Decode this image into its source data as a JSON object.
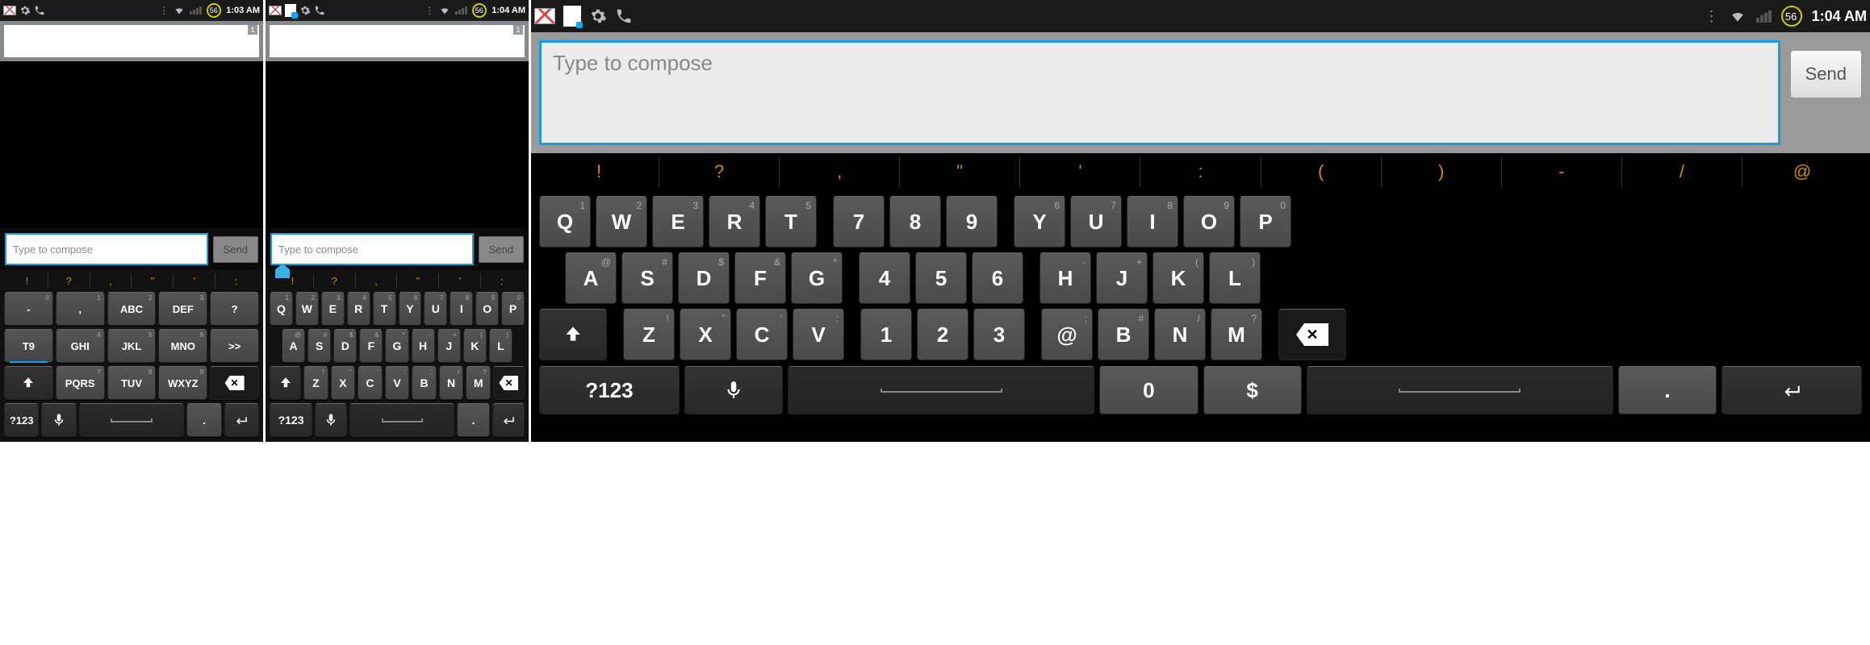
{
  "screens": [
    {
      "status": {
        "time": "1:03 AM",
        "battery": "56",
        "has_sd": false
      },
      "recipient_count": "1",
      "compose_placeholder": "Type to compose",
      "send_label": "Send",
      "keyboard_type": "t9",
      "punct": [
        "!",
        "?",
        ",",
        "\"",
        "'",
        ":"
      ],
      "t9_rows": [
        [
          {
            "main": "-",
            "sup": "0"
          },
          {
            "main": ",",
            "sup": "1"
          },
          {
            "main": "ABC",
            "sup": "2"
          },
          {
            "main": "DEF",
            "sup": "3"
          },
          {
            "main": "?",
            "sup": ""
          }
        ],
        [
          {
            "main": "T9",
            "sup": "",
            "t9": true
          },
          {
            "main": "GHI",
            "sup": "4"
          },
          {
            "main": "JKL",
            "sup": "5"
          },
          {
            "main": "MNO",
            "sup": "6"
          },
          {
            "main": ">>",
            "sup": ""
          }
        ],
        [
          {
            "main": "shift",
            "sup": ""
          },
          {
            "main": "PQRS",
            "sup": "7"
          },
          {
            "main": "TUV",
            "sup": "8"
          },
          {
            "main": "WXYZ",
            "sup": "9"
          },
          {
            "main": "backspace",
            "sup": ""
          }
        ],
        [
          {
            "main": "?123",
            "sup": ""
          },
          {
            "main": "mic",
            "sup": ""
          },
          {
            "main": "space",
            "sup": ""
          },
          {
            "main": ".",
            "sup": ""
          },
          {
            "main": "enter",
            "sup": ""
          }
        ]
      ]
    },
    {
      "status": {
        "time": "1:04 AM",
        "battery": "56",
        "has_sd": true
      },
      "recipient_count": "1",
      "compose_placeholder": "Type to compose",
      "send_label": "Send",
      "keyboard_type": "qwerty",
      "punct": [
        "!",
        "?",
        ",",
        "\"",
        "'",
        ":"
      ],
      "qwerty_rows": [
        [
          {
            "main": "Q",
            "sup": "1"
          },
          {
            "main": "W",
            "sup": "2"
          },
          {
            "main": "E",
            "sup": "3"
          },
          {
            "main": "R",
            "sup": "4"
          },
          {
            "main": "T",
            "sup": "5"
          },
          {
            "main": "Y",
            "sup": "6"
          },
          {
            "main": "U",
            "sup": "7"
          },
          {
            "main": "I",
            "sup": "8"
          },
          {
            "main": "O",
            "sup": "9"
          },
          {
            "main": "P",
            "sup": "0"
          }
        ],
        [
          {
            "main": "A",
            "sup": "@"
          },
          {
            "main": "S",
            "sup": "#"
          },
          {
            "main": "D",
            "sup": "$"
          },
          {
            "main": "F",
            "sup": "&"
          },
          {
            "main": "G",
            "sup": "*"
          },
          {
            "main": "H",
            "sup": "-"
          },
          {
            "main": "J",
            "sup": "+"
          },
          {
            "main": "K",
            "sup": "("
          },
          {
            "main": "L",
            "sup": ")"
          }
        ],
        [
          {
            "main": "shift",
            "sup": ""
          },
          {
            "main": "Z",
            "sup": "!"
          },
          {
            "main": "X",
            "sup": "\""
          },
          {
            "main": "C",
            "sup": "'"
          },
          {
            "main": "V",
            "sup": ":"
          },
          {
            "main": "B",
            "sup": ";"
          },
          {
            "main": "N",
            "sup": "/"
          },
          {
            "main": "M",
            "sup": "?"
          },
          {
            "main": "backspace",
            "sup": ""
          }
        ],
        [
          {
            "main": "?123",
            "sup": ""
          },
          {
            "main": "mic",
            "sup": ""
          },
          {
            "main": "space",
            "sup": ""
          },
          {
            "main": ".",
            "sup": ""
          },
          {
            "main": "enter",
            "sup": ""
          }
        ]
      ]
    },
    {
      "status": {
        "time": "1:04 AM",
        "battery": "56",
        "has_sd": true
      },
      "compose_placeholder": "Type to compose",
      "send_label": "Send",
      "keyboard_type": "qwerty_land",
      "punct": [
        "!",
        "?",
        ",",
        "\"",
        "'",
        ":",
        "(",
        ")",
        "-",
        "/",
        "@"
      ],
      "land_rows": [
        {
          "group1": [
            {
              "main": "Q",
              "sup": "1"
            },
            {
              "main": "W",
              "sup": "2"
            },
            {
              "main": "E",
              "sup": "3"
            },
            {
              "main": "R",
              "sup": "4"
            },
            {
              "main": "T",
              "sup": "5"
            }
          ],
          "group2": [
            {
              "main": "7",
              "sup": ""
            },
            {
              "main": "8",
              "sup": ""
            },
            {
              "main": "9",
              "sup": ""
            }
          ],
          "group3": [
            {
              "main": "Y",
              "sup": "6"
            },
            {
              "main": "U",
              "sup": "7"
            },
            {
              "main": "I",
              "sup": "8"
            },
            {
              "main": "O",
              "sup": "9"
            },
            {
              "main": "P",
              "sup": "0"
            }
          ]
        },
        {
          "group1": [
            {
              "main": "A",
              "sup": "@"
            },
            {
              "main": "S",
              "sup": "#"
            },
            {
              "main": "D",
              "sup": "$"
            },
            {
              "main": "F",
              "sup": "&"
            },
            {
              "main": "G",
              "sup": "*"
            }
          ],
          "group2": [
            {
              "main": "4",
              "sup": ""
            },
            {
              "main": "5",
              "sup": ""
            },
            {
              "main": "6",
              "sup": ""
            }
          ],
          "group3": [
            {
              "main": "H",
              "sup": "-"
            },
            {
              "main": "J",
              "sup": "+"
            },
            {
              "main": "K",
              "sup": "("
            },
            {
              "main": "L",
              "sup": ")"
            }
          ]
        },
        {
          "group0": [
            {
              "main": "shift",
              "sup": ""
            }
          ],
          "group1": [
            {
              "main": "Z",
              "sup": "!"
            },
            {
              "main": "X",
              "sup": "\""
            },
            {
              "main": "C",
              "sup": "'"
            },
            {
              "main": "V",
              "sup": ":"
            }
          ],
          "group2": [
            {
              "main": "1",
              "sup": ""
            },
            {
              "main": "2",
              "sup": ""
            },
            {
              "main": "3",
              "sup": ""
            }
          ],
          "group3": [
            {
              "main": "@",
              "sup": ";"
            },
            {
              "main": "B",
              "sup": "#"
            },
            {
              "main": "N",
              "sup": "/"
            },
            {
              "main": "M",
              "sup": "?"
            }
          ],
          "group4": [
            {
              "main": "backspace",
              "sup": ""
            }
          ]
        }
      ],
      "land_bottom": [
        {
          "main": "?123",
          "flex": 1
        },
        {
          "main": "mic",
          "flex": 0.7
        },
        {
          "main": "space",
          "flex": 2.2
        },
        {
          "main": "0",
          "flex": 0.7
        },
        {
          "main": "$",
          "flex": 0.7
        },
        {
          "main": "space2",
          "flex": 2.2
        },
        {
          "main": ".",
          "flex": 0.7
        },
        {
          "main": "enter",
          "flex": 1
        }
      ]
    }
  ]
}
